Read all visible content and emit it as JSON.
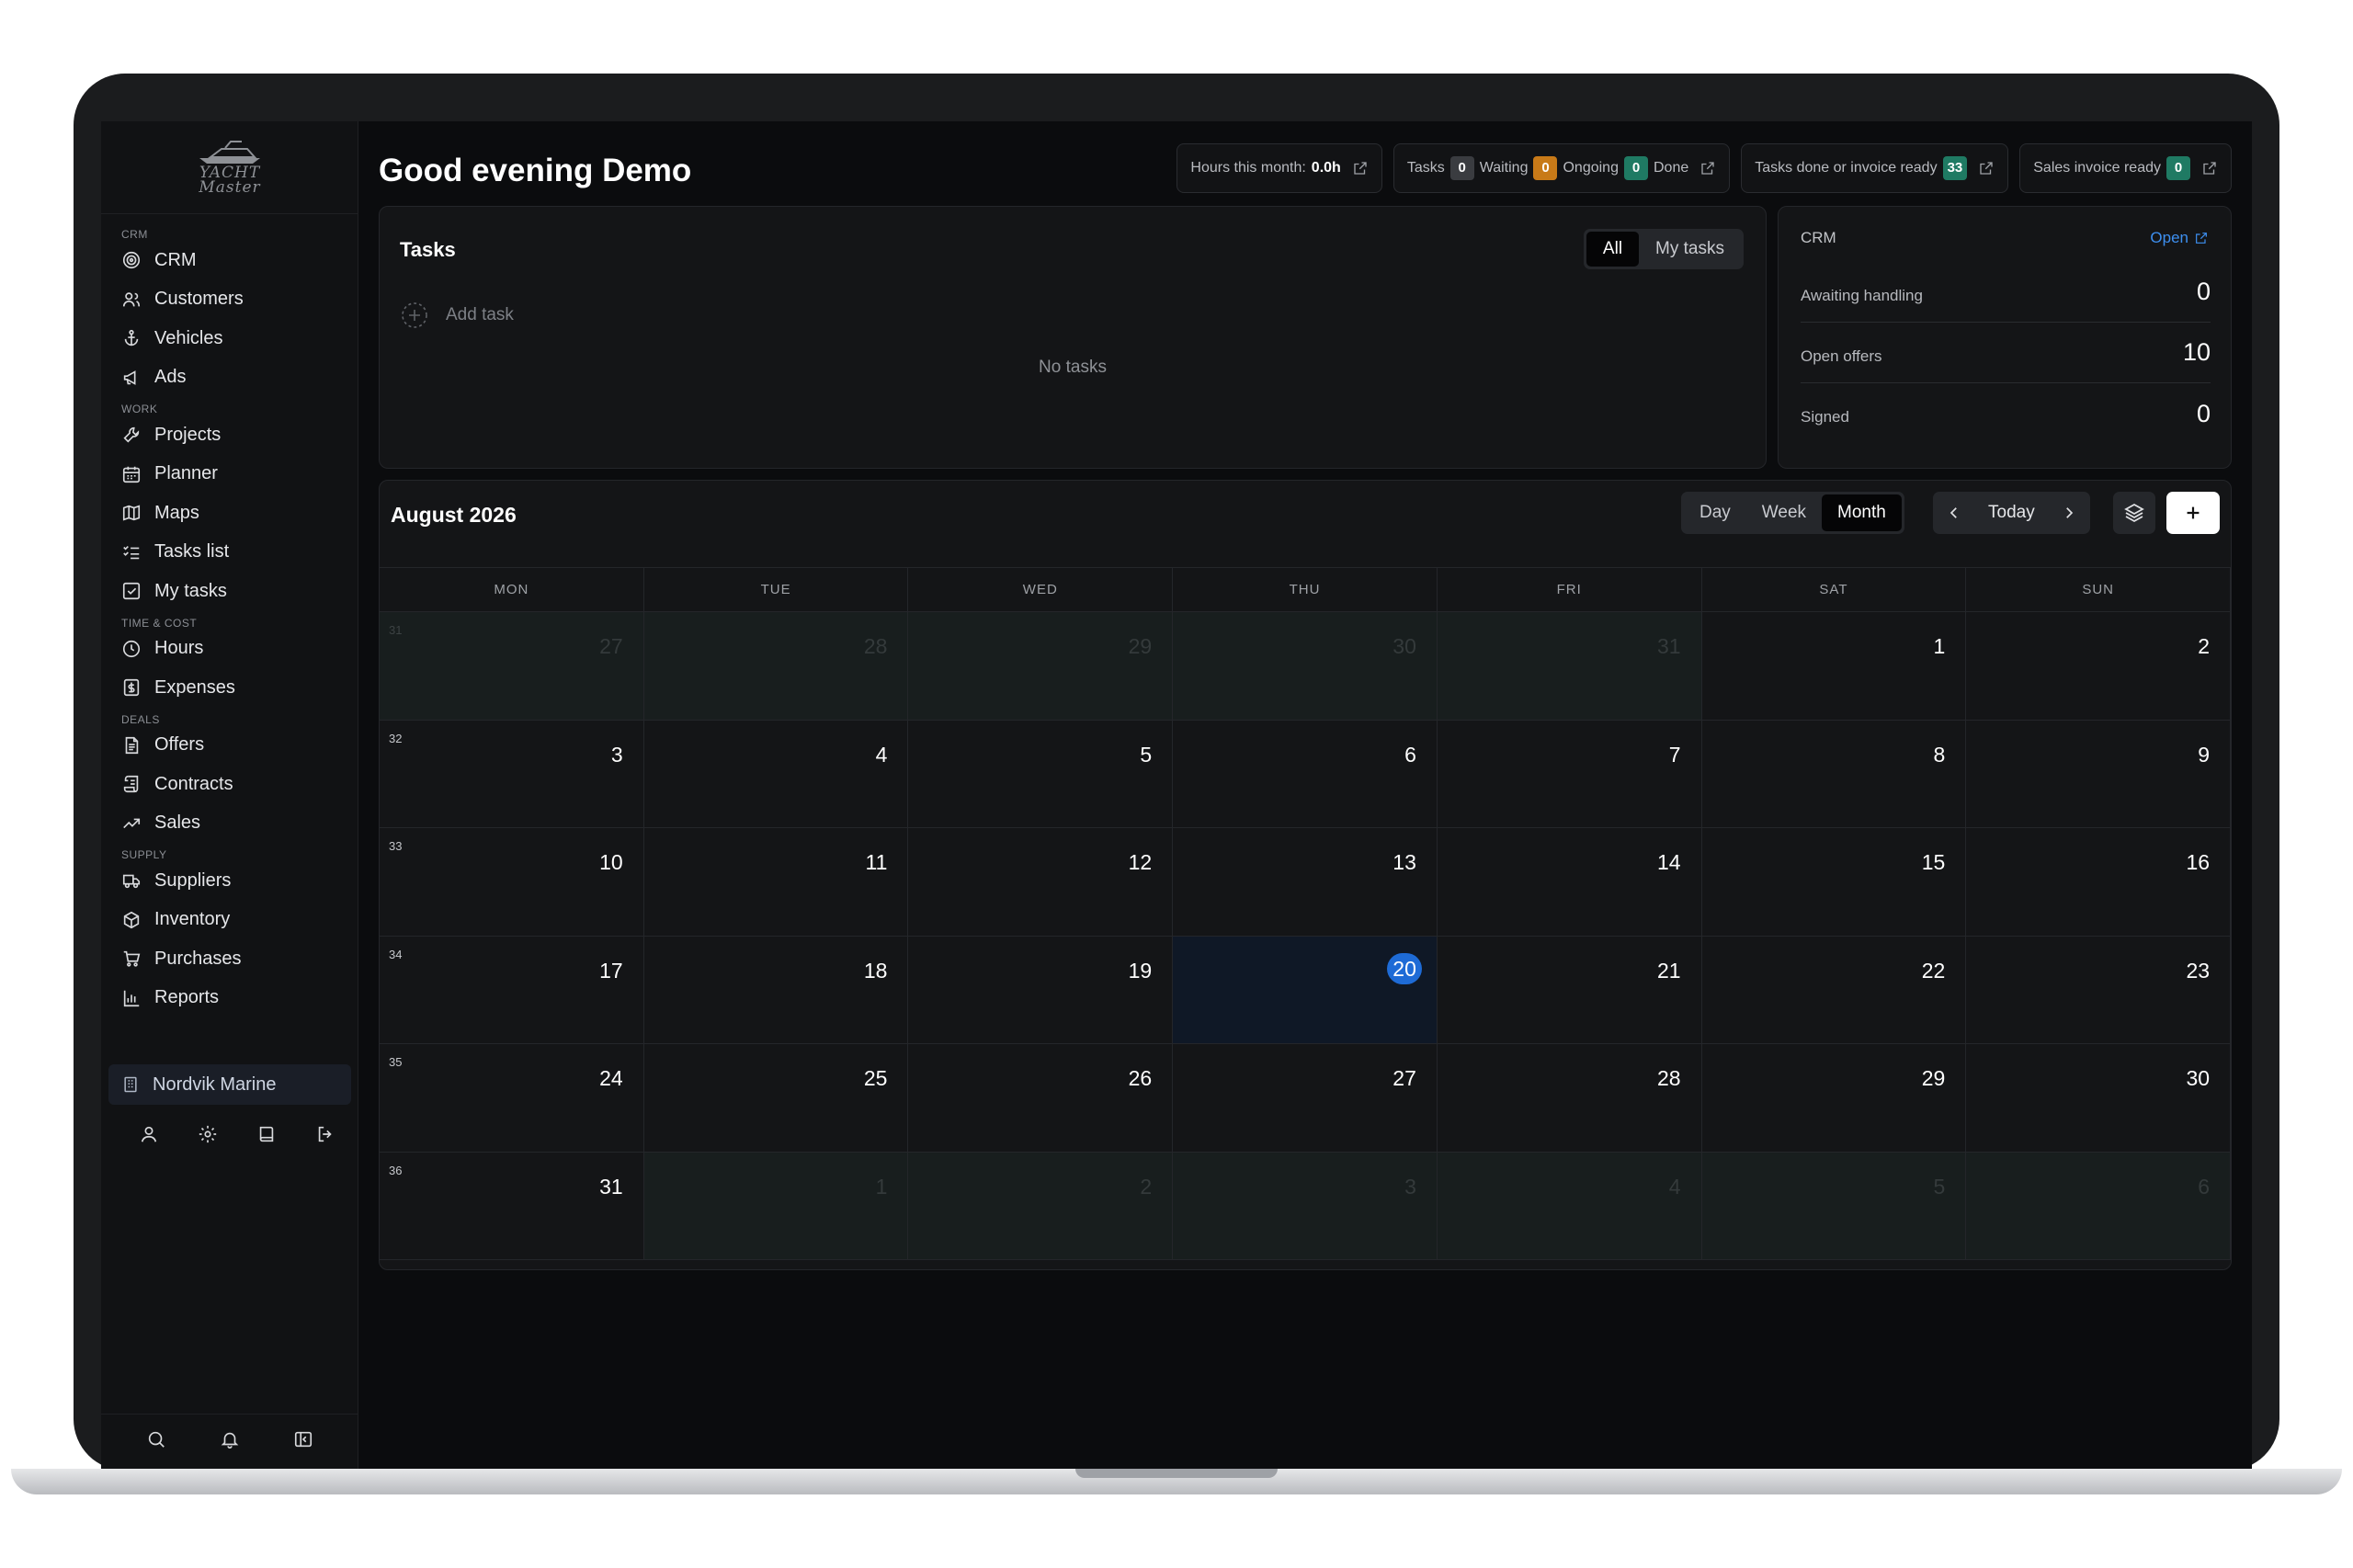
{
  "app": {
    "logo_line1": "YACHT",
    "logo_line2": "Master"
  },
  "sidebar": {
    "sections": [
      {
        "title": "CRM",
        "items": [
          {
            "label": "CRM",
            "icon": "target-icon"
          },
          {
            "label": "Customers",
            "icon": "users-icon"
          },
          {
            "label": "Vehicles",
            "icon": "anchor-icon"
          },
          {
            "label": "Ads",
            "icon": "megaphone-icon"
          }
        ]
      },
      {
        "title": "WORK",
        "items": [
          {
            "label": "Projects",
            "icon": "wrench-icon"
          },
          {
            "label": "Planner",
            "icon": "calendar-icon"
          },
          {
            "label": "Maps",
            "icon": "map-icon"
          },
          {
            "label": "Tasks list",
            "icon": "list-checks-icon"
          },
          {
            "label": "My tasks",
            "icon": "checkbox-icon"
          }
        ]
      },
      {
        "title": "TIME & COST",
        "items": [
          {
            "label": "Hours",
            "icon": "clock-icon"
          },
          {
            "label": "Expenses",
            "icon": "receipt-icon"
          }
        ]
      },
      {
        "title": "DEALS",
        "items": [
          {
            "label": "Offers",
            "icon": "document-icon"
          },
          {
            "label": "Contracts",
            "icon": "scroll-icon"
          },
          {
            "label": "Sales",
            "icon": "trending-up-icon"
          }
        ]
      },
      {
        "title": "SUPPLY",
        "items": [
          {
            "label": "Suppliers",
            "icon": "truck-icon"
          },
          {
            "label": "Inventory",
            "icon": "package-icon"
          },
          {
            "label": "Purchases",
            "icon": "cart-icon"
          },
          {
            "label": "Reports",
            "icon": "bar-chart-icon"
          }
        ]
      }
    ],
    "workspace": "Nordvik Marine"
  },
  "header": {
    "greeting": "Good evening Demo",
    "hours_label": "Hours this month:",
    "hours_value": "0.0h",
    "tasks_label": "Tasks",
    "tasks_count": "0",
    "waiting_label": "Waiting",
    "waiting_count": "0",
    "ongoing_label": "Ongoing",
    "ongoing_count": "0",
    "done_label": "Done",
    "invoice_label": "Tasks done or invoice ready",
    "invoice_count": "33",
    "sales_label": "Sales invoice ready",
    "sales_count": "0"
  },
  "tasks": {
    "title": "Tasks",
    "filter_all": "All",
    "filter_mine": "My tasks",
    "add_task": "Add task",
    "empty": "No tasks"
  },
  "crm": {
    "title": "CRM",
    "open_link": "Open",
    "rows": [
      {
        "label": "Awaiting handling",
        "value": "0"
      },
      {
        "label": "Open offers",
        "value": "10"
      },
      {
        "label": "Signed",
        "value": "0"
      }
    ]
  },
  "calendar": {
    "title": "August 2026",
    "views": [
      "Day",
      "Week",
      "Month"
    ],
    "active_view": "Month",
    "today_label": "Today",
    "weekdays": [
      "MON",
      "TUE",
      "WED",
      "THU",
      "FRI",
      "SAT",
      "SUN"
    ],
    "weeks": [
      {
        "week": "31",
        "days": [
          {
            "d": "27",
            "out": true
          },
          {
            "d": "28",
            "out": true
          },
          {
            "d": "29",
            "out": true
          },
          {
            "d": "30",
            "out": true
          },
          {
            "d": "31",
            "out": true
          },
          {
            "d": "1"
          },
          {
            "d": "2"
          }
        ]
      },
      {
        "week": "32",
        "days": [
          {
            "d": "3"
          },
          {
            "d": "4"
          },
          {
            "d": "5"
          },
          {
            "d": "6"
          },
          {
            "d": "7"
          },
          {
            "d": "8"
          },
          {
            "d": "9"
          }
        ]
      },
      {
        "week": "33",
        "days": [
          {
            "d": "10"
          },
          {
            "d": "11"
          },
          {
            "d": "12"
          },
          {
            "d": "13"
          },
          {
            "d": "14"
          },
          {
            "d": "15"
          },
          {
            "d": "16"
          }
        ]
      },
      {
        "week": "34",
        "days": [
          {
            "d": "17"
          },
          {
            "d": "18"
          },
          {
            "d": "19"
          },
          {
            "d": "20",
            "today": true
          },
          {
            "d": "21"
          },
          {
            "d": "22"
          },
          {
            "d": "23"
          }
        ]
      },
      {
        "week": "35",
        "days": [
          {
            "d": "24"
          },
          {
            "d": "25"
          },
          {
            "d": "26"
          },
          {
            "d": "27"
          },
          {
            "d": "28"
          },
          {
            "d": "29"
          },
          {
            "d": "30"
          }
        ]
      },
      {
        "week": "36",
        "days": [
          {
            "d": "31"
          },
          {
            "d": "1",
            "out": true
          },
          {
            "d": "2",
            "out": true
          },
          {
            "d": "3",
            "out": true
          },
          {
            "d": "4",
            "out": true
          },
          {
            "d": "5",
            "out": true
          },
          {
            "d": "6",
            "out": true
          }
        ]
      }
    ]
  },
  "colors": {
    "accent": "#1e6bd6",
    "link": "#3d8ff0",
    "badge_waiting": "#c87a18",
    "badge_ready": "#1f7a63"
  }
}
